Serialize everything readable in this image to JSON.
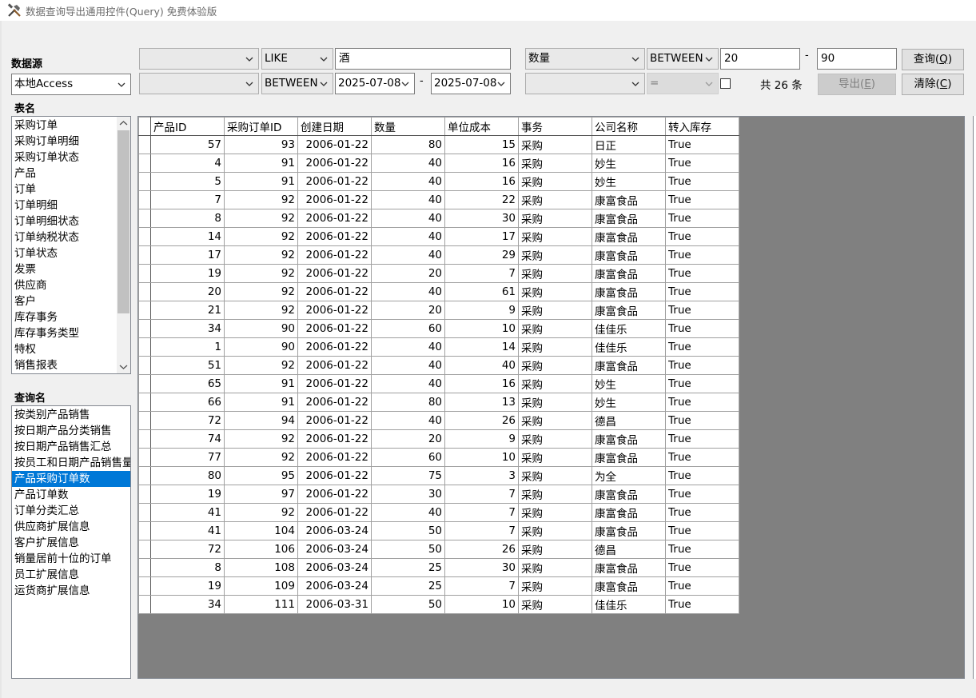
{
  "window": {
    "title": "数据查询导出通用控件(Query) 免费体验版",
    "icon": "tools-icon"
  },
  "datasource": {
    "label": "数据源",
    "value": "本地Access"
  },
  "filters": {
    "row1_left": {
      "field": "",
      "operator": "LIKE",
      "value": "酒"
    },
    "row2_left": {
      "field": "",
      "operator": "BETWEEN",
      "from": "2025-07-08",
      "to": "2025-07-08"
    },
    "row1_right": {
      "field": "数量",
      "operator": "BETWEEN",
      "from": "20",
      "to": "90"
    },
    "row2_right": {
      "field": "",
      "operator": "="
    },
    "range_dash": "-"
  },
  "count_text": "共 26 条",
  "buttons": {
    "query": {
      "label": "查询(",
      "key": "Q",
      "suffix": ")"
    },
    "export": {
      "label": "导出(",
      "key": "E",
      "suffix": ")"
    },
    "clear": {
      "label": "清除(",
      "key": "C",
      "suffix": ")"
    }
  },
  "tables": {
    "label": "表名",
    "items": [
      "采购订单",
      "采购订单明细",
      "采购订单状态",
      "产品",
      "订单",
      "订单明细",
      "订单明细状态",
      "订单纳税状态",
      "订单状态",
      "发票",
      "供应商",
      "客户",
      "库存事务",
      "库存事务类型",
      "特权",
      "销售报表"
    ]
  },
  "queries": {
    "label": "查询名",
    "selected_index": 4,
    "items": [
      "按类别产品销售",
      "按日期产品分类销售",
      "按日期产品销售汇总",
      "按员工和日期产品销售量",
      "产品采购订单数",
      "产品订单数",
      "订单分类汇总",
      "供应商扩展信息",
      "客户扩展信息",
      "销量居前十位的订单",
      "员工扩展信息",
      "运货商扩展信息"
    ]
  },
  "grid": {
    "columns": [
      "产品ID",
      "采购订单ID",
      "创建日期",
      "数量",
      "单位成本",
      "事务",
      "公司名称",
      "转入库存"
    ],
    "rows": [
      [
        "57",
        "93",
        "2006-01-22",
        "80",
        "15",
        "采购",
        "日正",
        "True"
      ],
      [
        "4",
        "91",
        "2006-01-22",
        "40",
        "16",
        "采购",
        "妙生",
        "True"
      ],
      [
        "5",
        "91",
        "2006-01-22",
        "40",
        "16",
        "采购",
        "妙生",
        "True"
      ],
      [
        "7",
        "92",
        "2006-01-22",
        "40",
        "22",
        "采购",
        "康富食品",
        "True"
      ],
      [
        "8",
        "92",
        "2006-01-22",
        "40",
        "30",
        "采购",
        "康富食品",
        "True"
      ],
      [
        "14",
        "92",
        "2006-01-22",
        "40",
        "17",
        "采购",
        "康富食品",
        "True"
      ],
      [
        "17",
        "92",
        "2006-01-22",
        "40",
        "29",
        "采购",
        "康富食品",
        "True"
      ],
      [
        "19",
        "92",
        "2006-01-22",
        "20",
        "7",
        "采购",
        "康富食品",
        "True"
      ],
      [
        "20",
        "92",
        "2006-01-22",
        "40",
        "61",
        "采购",
        "康富食品",
        "True"
      ],
      [
        "21",
        "92",
        "2006-01-22",
        "20",
        "9",
        "采购",
        "康富食品",
        "True"
      ],
      [
        "34",
        "90",
        "2006-01-22",
        "60",
        "10",
        "采购",
        "佳佳乐",
        "True"
      ],
      [
        "1",
        "90",
        "2006-01-22",
        "40",
        "14",
        "采购",
        "佳佳乐",
        "True"
      ],
      [
        "51",
        "92",
        "2006-01-22",
        "40",
        "40",
        "采购",
        "康富食品",
        "True"
      ],
      [
        "65",
        "91",
        "2006-01-22",
        "40",
        "16",
        "采购",
        "妙生",
        "True"
      ],
      [
        "66",
        "91",
        "2006-01-22",
        "80",
        "13",
        "采购",
        "妙生",
        "True"
      ],
      [
        "72",
        "94",
        "2006-01-22",
        "40",
        "26",
        "采购",
        "德昌",
        "True"
      ],
      [
        "74",
        "92",
        "2006-01-22",
        "20",
        "9",
        "采购",
        "康富食品",
        "True"
      ],
      [
        "77",
        "92",
        "2006-01-22",
        "60",
        "10",
        "采购",
        "康富食品",
        "True"
      ],
      [
        "80",
        "95",
        "2006-01-22",
        "75",
        "3",
        "采购",
        "为全",
        "True"
      ],
      [
        "19",
        "97",
        "2006-01-22",
        "30",
        "7",
        "采购",
        "康富食品",
        "True"
      ],
      [
        "41",
        "92",
        "2006-01-22",
        "40",
        "7",
        "采购",
        "康富食品",
        "True"
      ],
      [
        "41",
        "104",
        "2006-03-24",
        "50",
        "7",
        "采购",
        "康富食品",
        "True"
      ],
      [
        "72",
        "106",
        "2006-03-24",
        "50",
        "26",
        "采购",
        "德昌",
        "True"
      ],
      [
        "8",
        "108",
        "2006-03-24",
        "25",
        "30",
        "采购",
        "康富食品",
        "True"
      ],
      [
        "19",
        "109",
        "2006-03-24",
        "25",
        "7",
        "采购",
        "康富食品",
        "True"
      ],
      [
        "34",
        "111",
        "2006-03-31",
        "50",
        "10",
        "采购",
        "佳佳乐",
        "True"
      ]
    ]
  },
  "colors": {
    "selection": "#0078d7",
    "grid_background": "#808080"
  }
}
